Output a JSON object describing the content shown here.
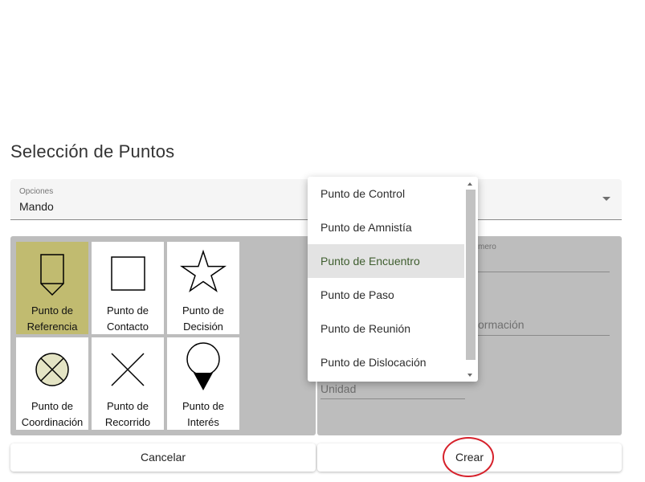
{
  "dialog": {
    "title": "Selección de Puntos"
  },
  "select": {
    "label": "Opciones",
    "value": "Mando"
  },
  "tiles": [
    {
      "line1": "Punto de",
      "line2": "Referencia",
      "icon": "reference-point-icon",
      "selected": true
    },
    {
      "line1": "Punto de",
      "line2": "Contacto",
      "icon": "contact-point-icon"
    },
    {
      "line1": "Punto de",
      "line2": "Decisión",
      "icon": "decision-point-icon"
    },
    {
      "line1": "Punto de",
      "line2": "Coordinación",
      "icon": "coordination-point-icon"
    },
    {
      "line1": "Punto de",
      "line2": "Recorrido",
      "icon": "route-point-icon"
    },
    {
      "line1": "Punto de",
      "line2": "Interés",
      "icon": "interest-point-icon"
    }
  ],
  "form": {
    "numero_label_partial": "mero",
    "informacion_label_partial": "ormación",
    "unidad_label": "Unidad"
  },
  "dropdown": {
    "items": [
      "Punto de Control",
      "Punto de Amnistía",
      "Punto de Encuentro",
      "Punto de Paso",
      "Punto de Reunión",
      "Punto de Dislocación"
    ],
    "active_index": 2
  },
  "buttons": {
    "cancel": "Cancelar",
    "create": "Crear"
  },
  "colors": {
    "selected_tile": "#c1bb70",
    "panel": "#bdbdbd",
    "highlight": "#d6212b",
    "active_item_text": "#3f5e2f"
  }
}
